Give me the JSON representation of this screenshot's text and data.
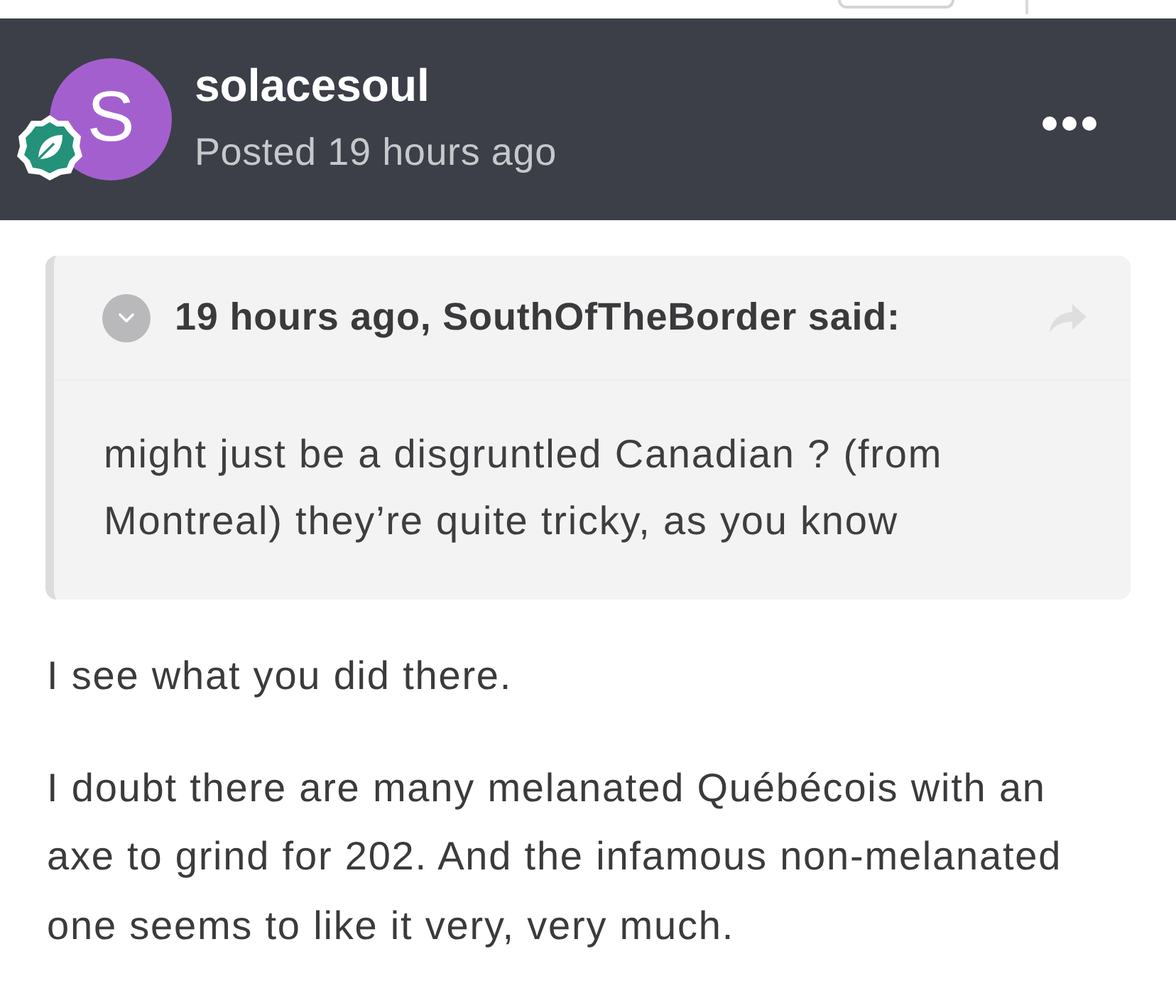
{
  "post": {
    "author": "solacesoul",
    "avatar_initial": "S",
    "posted": "Posted 19 hours ago"
  },
  "quote": {
    "header": "19 hours ago, SouthOfTheBorder said:",
    "text": "might just be a disgruntled Canadian ? (from Montreal) they’re quite tricky, as you know"
  },
  "paragraphs": [
    "I see what you did there.",
    "I doubt there are many melanated Québécois with an axe to grind for 202. And the infamous non-melanated one seems to like it very, very much."
  ]
}
